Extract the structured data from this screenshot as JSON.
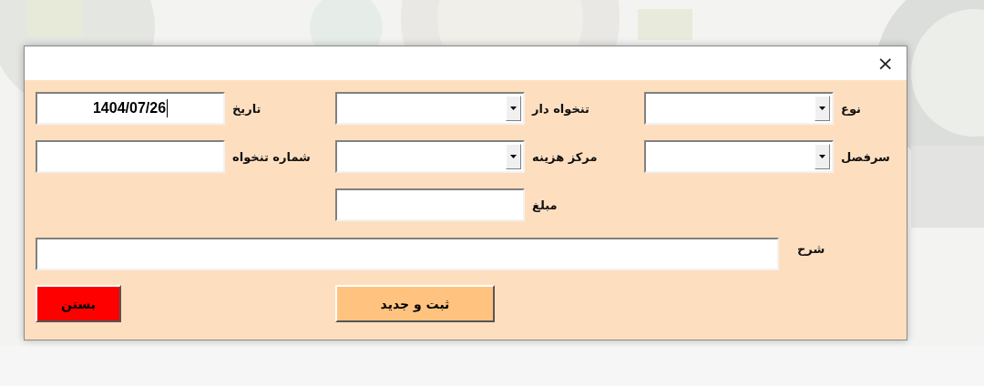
{
  "window": {
    "close": "×"
  },
  "columns": [
    [
      {
        "kind": "combo",
        "label": "نوع",
        "focused": false
      },
      {
        "kind": "combo",
        "label": "سرفصل",
        "focused": false
      }
    ],
    [
      {
        "kind": "combo",
        "label": "تنخواه دار",
        "focused": false
      },
      {
        "kind": "combo",
        "label": "مرکز هزینه",
        "focused": false
      },
      {
        "kind": "text",
        "label": "مبلغ",
        "focused": false
      }
    ],
    [
      {
        "kind": "text",
        "label": "تاریخ",
        "value": "1404/07/26",
        "focused": true
      },
      {
        "kind": "text",
        "label": "شماره تنخواه",
        "focused": false
      }
    ]
  ],
  "description": {
    "label": "شرح"
  },
  "buttons": [
    {
      "label": "ثبت و جدید",
      "color": "#ffc37f"
    },
    {
      "label": "بستن",
      "color": "#ff0000"
    }
  ]
}
